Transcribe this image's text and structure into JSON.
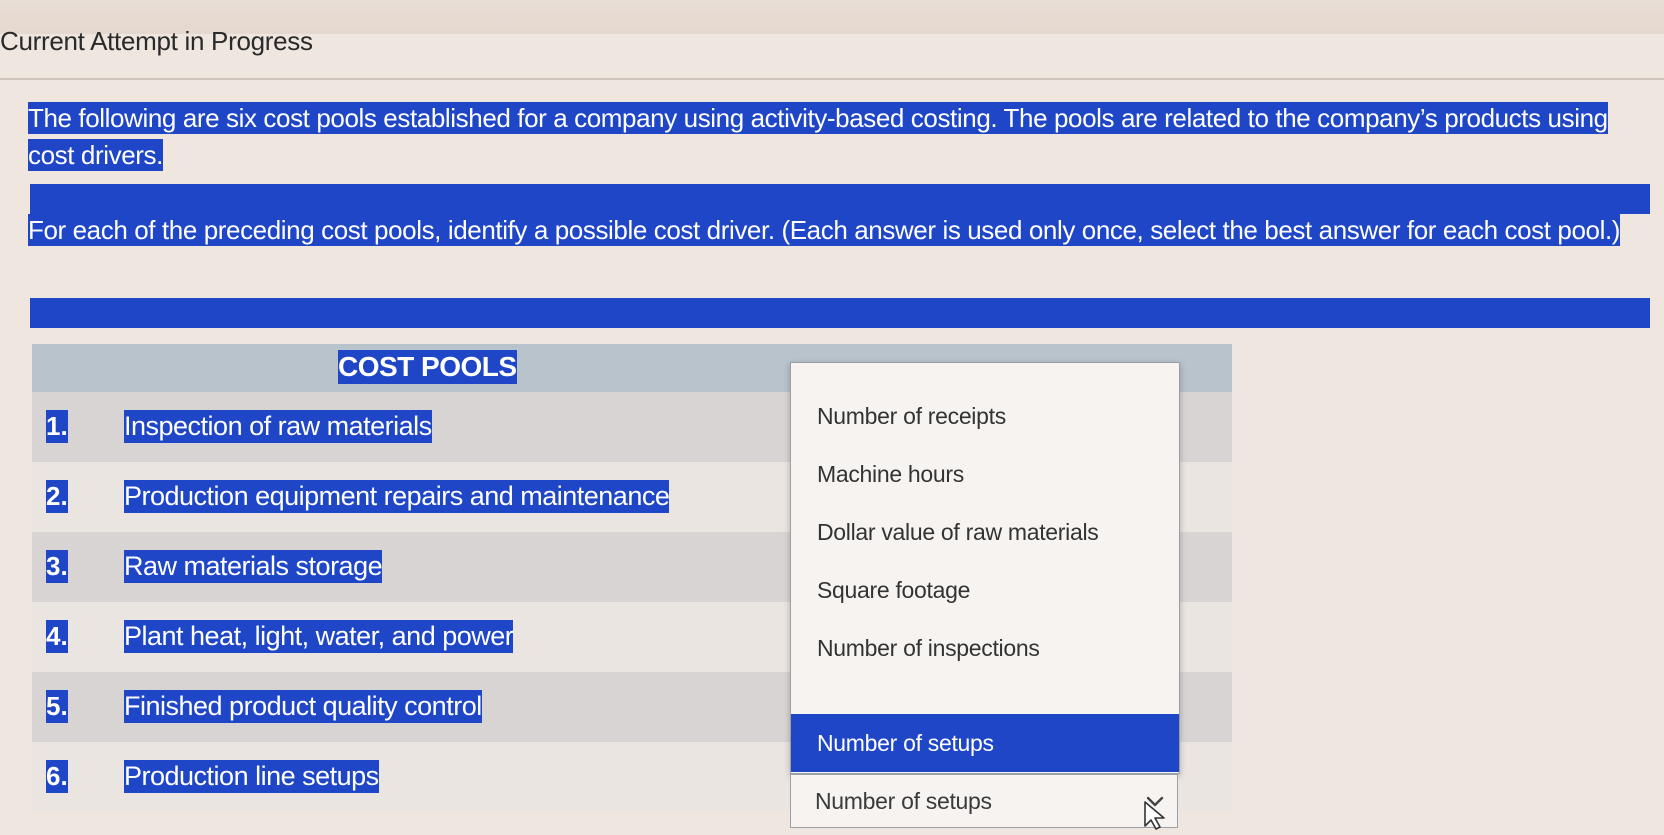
{
  "header": {
    "title": "Current Attempt in Progress"
  },
  "question": {
    "intro": "The following are six cost pools established for a company using activity-based costing. The pools are related to the company’s products using cost drivers.",
    "instruction": "For each of the preceding cost pools, identify a possible cost driver. (Each answer is used only once, select the best answer for each cost pool.)"
  },
  "table": {
    "col_cost_pools": "COST POOLS",
    "rows": [
      {
        "num": "1.",
        "pool": "Inspection of raw materials"
      },
      {
        "num": "2.",
        "pool": "Production equipment repairs and maintenance"
      },
      {
        "num": "3.",
        "pool": "Raw materials storage"
      },
      {
        "num": "4.",
        "pool": "Plant heat, light, water, and power"
      },
      {
        "num": "5.",
        "pool": "Finished product quality control"
      },
      {
        "num": "6.",
        "pool": "Production line setups"
      }
    ]
  },
  "dropdown": {
    "options": [
      "Number of receipts",
      "Machine hours",
      "Dollar value of raw materials",
      "Square footage",
      "Number of inspections",
      "Number of setups"
    ],
    "highlighted_option": "Number of setups",
    "selected_value": "Number of setups",
    "icon": "chevron-down-icon"
  },
  "colors": {
    "selection_highlight": "#1f46c7",
    "header_band": "#b9c3cc",
    "row_shaded": "#d8d4d3",
    "page_background": "#efe6df"
  }
}
